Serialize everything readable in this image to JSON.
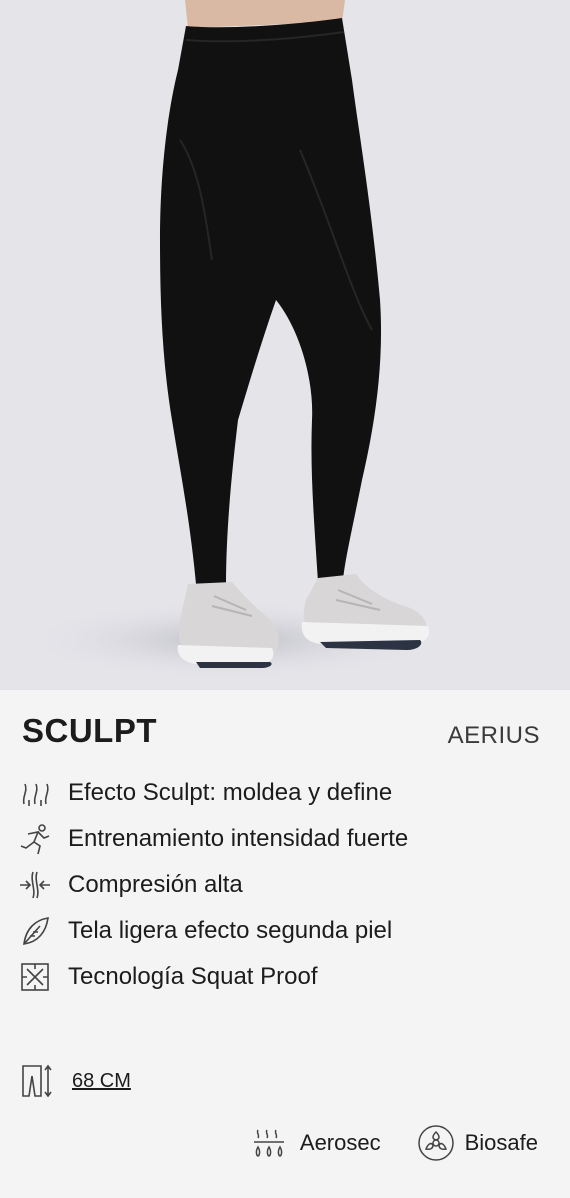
{
  "product": {
    "name": "SCULPT",
    "brand": "AERIUS",
    "image_alt": "Black high-waist leggings with white sneakers"
  },
  "features": [
    {
      "icon": "sculpt-waves-icon",
      "label": "Efecto Sculpt: moldea y define"
    },
    {
      "icon": "runner-icon",
      "label": "Entrenamiento intensidad fuerte"
    },
    {
      "icon": "compression-arrows-icon",
      "label": "Compresión alta"
    },
    {
      "icon": "feather-leaf-icon",
      "label": "Tela ligera efecto segunda piel"
    },
    {
      "icon": "squat-proof-icon",
      "label": "Tecnología Squat Proof"
    }
  ],
  "length": {
    "icon": "leggings-length-icon",
    "label": "68 CM"
  },
  "badges": [
    {
      "icon": "aerosec-icon",
      "label": "Aerosec"
    },
    {
      "icon": "biosafe-icon",
      "label": "Biosafe"
    }
  ],
  "colors": {
    "image_bg": "#e4e4e9",
    "card_bg": "#f4f4f4",
    "legging": "#111111",
    "text": "#1c1c1c"
  }
}
